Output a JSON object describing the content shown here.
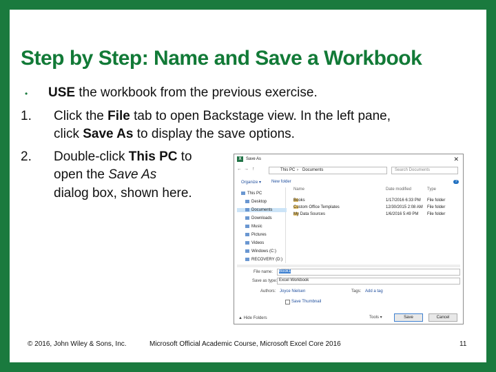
{
  "slide": {
    "title": "Step by Step: Name and Save a Workbook",
    "bullet": {
      "marker": "•",
      "bold": "USE",
      "text": "the workbook from the previous exercise."
    },
    "step1": {
      "number": "1.",
      "a": "Click the",
      "b1": "File",
      "c": "tab to open Backstage view. In the left pane,",
      "d": "click",
      "b2": "Save As",
      "e": "to display the save options."
    },
    "step2": {
      "number": "2.",
      "a": "Double-click",
      "b1": "This PC",
      "c": "to",
      "d": "open the",
      "i1": "Save As",
      "e": "dialog box, shown here."
    },
    "footer": {
      "copyright": "© 2016, John Wiley & Sons, Inc.",
      "course": "Microsoft Official Academic Course, Microsoft Excel Core 2016",
      "page": "11"
    }
  },
  "dialog": {
    "app_icon": "X",
    "title": "Save As",
    "close": "✕",
    "nav": {
      "back": "←",
      "forward": "→",
      "up": "↑"
    },
    "path": {
      "root": "This PC",
      "sep": "›",
      "current": "Documents"
    },
    "search_placeholder": "Search Documents",
    "toolbar": {
      "organize": "Organize ▾",
      "new_folder": "New folder",
      "help": "?"
    },
    "nav_items": [
      {
        "label": "This PC",
        "icon": "computer-icon"
      },
      {
        "label": "Desktop",
        "icon": "desktop-icon"
      },
      {
        "label": "Documents",
        "icon": "documents-icon",
        "selected": true
      },
      {
        "label": "Downloads",
        "icon": "download-icon"
      },
      {
        "label": "Music",
        "icon": "music-icon"
      },
      {
        "label": "Pictures",
        "icon": "pictures-icon"
      },
      {
        "label": "Videos",
        "icon": "videos-icon"
      },
      {
        "label": "Windows (C:)",
        "icon": "drive-icon"
      },
      {
        "label": "RECOVERY (D:)",
        "icon": "drive-icon"
      }
    ],
    "columns": {
      "name": "Name",
      "date": "Date modified",
      "type": "Type"
    },
    "files": [
      {
        "name": "Books",
        "date": "1/17/2016 6:33 PM",
        "type": "File folder"
      },
      {
        "name": "Custom Office Templates",
        "date": "12/30/2015 2:08 AM",
        "type": "File folder"
      },
      {
        "name": "My Data Sources",
        "date": "1/6/2016 5:49 PM",
        "type": "File folder"
      }
    ],
    "file_name_label": "File name:",
    "file_name_value": "Book1",
    "save_type_label": "Save as type:",
    "save_type_value": "Excel Workbook",
    "authors_label": "Authors:",
    "authors_value": "Joyce Nielsen",
    "tags_label": "Tags:",
    "tags_value": "Add a tag",
    "thumbnail_label": "Save Thumbnail",
    "hide_folders": "▲ Hide Folders",
    "tools": "Tools ▾",
    "save": "Save",
    "cancel": "Cancel"
  },
  "colors": {
    "brand_green": "#1a7a3e",
    "title_green": "#127a37",
    "excel_green": "#217346"
  }
}
